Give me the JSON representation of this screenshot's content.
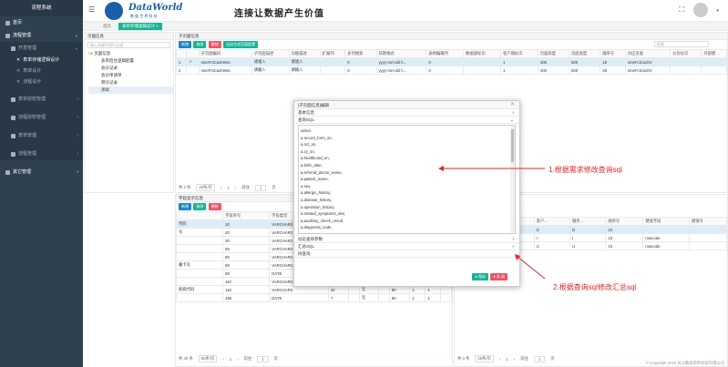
{
  "sidebar": {
    "title": "流程系统",
    "items": [
      {
        "label": "首页",
        "level": 0
      },
      {
        "label": "流程管理",
        "level": 0,
        "open": true
      },
      {
        "label": "开发管理",
        "level": 1,
        "open": true
      },
      {
        "label": "表单存储逻辑设计",
        "level": 2,
        "active": true
      },
      {
        "label": "表单设计",
        "level": 2
      },
      {
        "label": "流程设计",
        "level": 2
      },
      {
        "label": "表单授权管理",
        "level": 1
      },
      {
        "label": "流程授权管理",
        "level": 1
      },
      {
        "label": "表单管理",
        "level": 1
      },
      {
        "label": "流程管理",
        "level": 1
      },
      {
        "label": "其它管理",
        "level": 0
      }
    ]
  },
  "header": {
    "logo_text": "DataWorld",
    "logo_sub": "数 据 世 界 科 技",
    "slogan": "连接让数据产生价值"
  },
  "tabs": [
    "首页",
    "表单存储逻辑设计 ×"
  ],
  "tree": {
    "title": "页面信息",
    "search_placeholder": "输入关键字进行过滤",
    "nodes": [
      "页面信息",
      "表单后台逻辑配置",
      "会诊记录",
      "会诊申请单",
      "转诊记录",
      "测试"
    ]
  },
  "top_grid": {
    "title": "子页面信息",
    "buttons": [
      "新增",
      "修改",
      "删除",
      "自动生成页面配置"
    ],
    "search_placeholder": "检索",
    "columns": [
      "",
      "",
      "子页面编码",
      "子页面描述",
      "功能描述",
      "扩展列",
      "多列搜索",
      "日期格式",
      "表格编辑列",
      "数据源标识",
      "客户端标识",
      "页面高度",
      "页面宽度",
      "顺序号",
      "对应页面",
      "分页标识",
      "外部键"
    ],
    "rows": [
      [
        "1",
        "✓",
        "smeFctCashWec",
        "诸诸入",
        "诸诸入",
        "",
        "0",
        "yyyy-mm-dd h...",
        "0",
        "",
        "1",
        "400",
        "500",
        "19",
        "smeFctCashV",
        "",
        ""
      ],
      [
        "2",
        "",
        "smeFctCashWec",
        "请输入",
        "请输入",
        "",
        "0",
        "yyyy-mm-dd h...",
        "0",
        "",
        "1",
        "400",
        "500",
        "29",
        "smeFctCashV",
        "",
        ""
      ]
    ],
    "footer": {
      "total": "共 2 条",
      "page_size": "20条/页",
      "page": "1",
      "goto": "前往",
      "page_suffix": "页"
    }
  },
  "bottom_left": {
    "title": "字段显示信息",
    "buttons": [
      "新增",
      "修改",
      "删除"
    ],
    "columns": [
      "",
      "字段序号",
      "字段类型",
      "",
      "",
      "",
      "",
      "",
      "",
      "",
      ""
    ],
    "rows": [
      [
        "代码",
        "10",
        "VARCHAR2",
        "32",
        "",
        "无",
        "",
        "80",
        "1",
        "1",
        ""
      ],
      [
        "号",
        "20",
        "VARCHAR2",
        "32",
        "",
        "无",
        "",
        "80",
        "1",
        "1",
        ""
      ],
      [
        "",
        "30",
        "VARCHAR2",
        "32",
        "",
        "无",
        "",
        "80",
        "1",
        "1",
        ""
      ],
      [
        "",
        "50",
        "VARCHAR2",
        "32",
        "",
        "无",
        "",
        "80",
        "1",
        "1",
        ""
      ],
      [
        "",
        "80",
        "VARCHAR2",
        "32",
        "",
        "无",
        "",
        "80",
        "1",
        "1",
        ""
      ],
      [
        "暮卡号",
        "90",
        "VARCHAR2",
        "32",
        "",
        "无",
        "",
        "80",
        "1",
        "1",
        ""
      ],
      [
        "",
        "90",
        "DATE",
        "7",
        "",
        "无",
        "",
        "80",
        "1",
        "1",
        ""
      ],
      [
        "",
        "110",
        "VARCHAR2",
        "32",
        "",
        "无",
        "",
        "80",
        "1",
        "1",
        ""
      ],
      [
        "疾病代码",
        "115",
        "VARCHAR2",
        "32",
        "",
        "无",
        "",
        "80",
        "1",
        "1",
        ""
      ],
      [
        "",
        "160",
        "DATE",
        "7",
        "",
        "无",
        "",
        "80",
        "1",
        "1",
        ""
      ]
    ],
    "footer": {
      "total": "共 40 条",
      "page_size": "50条/页",
      "page": "1",
      "goto": "前往",
      "page_suffix": "页"
    }
  },
  "bottom_right": {
    "columns": [
      "编码",
      "客户...",
      "服务...",
      "顺序号",
      "键值字段",
      "键值号"
    ],
    "rows": [
      [
        "smeFctCashWed",
        "D",
        "D",
        "10",
        "",
        ""
      ],
      [
        "smeFctCashWed",
        "I",
        "I",
        "10",
        "rowcode",
        ""
      ],
      [
        "smeFctCashWed",
        "U",
        "U",
        "10",
        "rowcode",
        ""
      ]
    ],
    "footer": {
      "total": "共 3 条",
      "page_size": "20条/页",
      "page": "1",
      "goto": "前往",
      "page_suffix": "页"
    }
  },
  "modal": {
    "title": "[子页面信息]编辑",
    "sections": [
      "基本信息",
      "查询SQL"
    ],
    "sql_lines": [
      "select",
      "a.record_form_sn,",
      "a.mz_sn,",
      "a.zy_sn,",
      "a.healthcard_sn,",
      "a.brith_date,",
      "a.referral_doctor_name,",
      "a.patient_name,",
      "a.sex,",
      "a.allergic_history,",
      "a.disease_history,",
      "a.operation_history,",
      "a.related_symptoms_des,",
      "a.auxiliary_check_result,",
      "a.diagnosis_code,"
    ],
    "sections_after": [
      "动态查询参数",
      "汇总SQL",
      "树查询"
    ],
    "save": "保存",
    "close": "关 闭"
  },
  "annotations": [
    "1.根据需求修改查询sql",
    "2.根据查询sql修改汇总sql"
  ],
  "footer_text": "© Copyright 2018 长沙数医软件科技有限公司",
  "colors": {
    "sidebar": "#2f4050",
    "accent": "#1ab394",
    "primary": "#1c84c6",
    "danger": "#ed5565",
    "annotation": "#e5242b"
  }
}
